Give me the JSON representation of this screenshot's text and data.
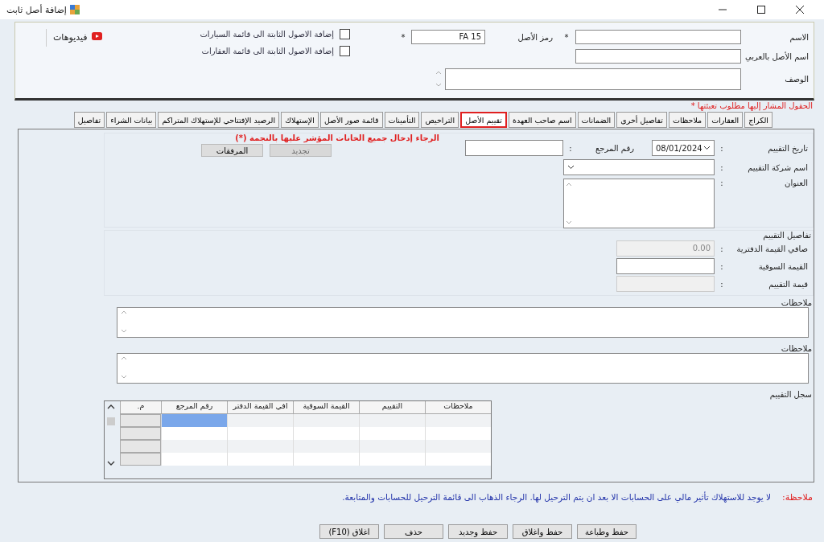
{
  "window": {
    "title": "إضافة أصل ثابت"
  },
  "header": {
    "name_label": "الاسم",
    "name_required": "*",
    "code_label": "رمز الأصل",
    "code_value": "FA 15",
    "code_required": "*",
    "arabic_name_label": "اسم الأصل بالعربي",
    "description_label": "الوصف",
    "checkboxes": [
      {
        "label": "إضافة الاصول الثابتة الى قائمة السيارات",
        "checked": false
      },
      {
        "label": "إضافة الاصول الثابتة الى قائمة العقارات",
        "checked": false
      }
    ],
    "videos_link": "فيديوهات"
  },
  "required_note": "الحقول المشار إليها مطلوب تعبئتها *",
  "tabs": [
    {
      "label": "الكراج",
      "selected": false
    },
    {
      "label": "العقارات",
      "selected": false
    },
    {
      "label": "ملاحظات",
      "selected": false
    },
    {
      "label": "تفاصيل أخرى",
      "selected": false
    },
    {
      "label": "الضمانات",
      "selected": false
    },
    {
      "label": "اسم صاحب العهدة",
      "selected": false
    },
    {
      "label": "تقييم الأصل",
      "selected": true
    },
    {
      "label": "التراخيص",
      "selected": false
    },
    {
      "label": "التأمينات",
      "selected": false
    },
    {
      "label": "قائمة صور الأصل",
      "selected": false
    },
    {
      "label": "الإستهلاك",
      "selected": false
    },
    {
      "label": "الرصيد الإفتتاحي للإستهلاك المتراكم",
      "selected": false
    },
    {
      "label": "بيانات الشراء",
      "selected": false
    },
    {
      "label": "تفاصيل",
      "selected": false
    }
  ],
  "valuation": {
    "date_label": "تاريخ التقييم",
    "date_value": "08/01/2024",
    "ref_label": "رقم المرجع",
    "company_label": "اسم شركة التقييم",
    "address_label": "العنوان",
    "colon": ":",
    "warning": "الرجاء إدخال جميع الخانات المؤشر عليها بالنجمة (*)",
    "buttons": [
      {
        "label": "تجديد",
        "disabled": true
      },
      {
        "label": "المرفقات",
        "disabled": false
      }
    ]
  },
  "details": {
    "title": "تفاصيل التقييم",
    "rows": [
      {
        "label": "صافي القيمة الدفترية",
        "value": "0.00",
        "disabled": true
      },
      {
        "label": "القيمة السوقية",
        "disabled": false
      },
      {
        "label": "قيمة التقييم",
        "disabled": true
      }
    ]
  },
  "notes": [
    {
      "label": "ملاحظات"
    },
    {
      "label": "ملاحظات"
    }
  ],
  "history": {
    "title": "سجل التقييم",
    "columns": [
      "ملاحظات",
      "التقييم",
      "القيمة السوقية",
      "افي القيمة الدفتر",
      "رقم المرجع",
      "م."
    ],
    "rows": [
      {
        "selected": true
      },
      {
        "selected": false
      },
      {
        "selected": false
      },
      {
        "selected": false
      }
    ]
  },
  "footer_note": {
    "label": "ملاحظة:",
    "text": "لا يوجد للاستهلاك تأثير مالي على الحسابات الا بعد ان يتم الترحيل لها. الرجاء الذهاب الى قائمة الترحيل للحسابات والمتابعة."
  },
  "buttons": [
    "حفظ وطباعة",
    "حفظ واغلاق",
    "حفظ وجديد",
    "حذف",
    "اغلاق (F10)"
  ]
}
